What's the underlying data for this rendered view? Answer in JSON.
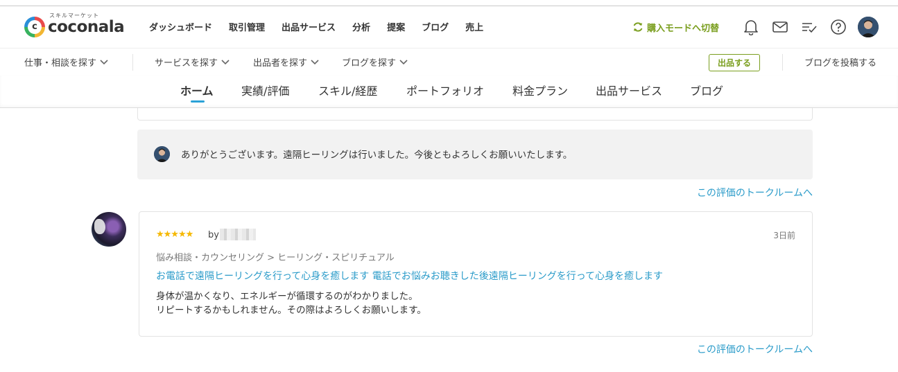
{
  "header": {
    "logo_sub": "スキルマーケット",
    "logo_word": "coconala",
    "nav": [
      "ダッシュボード",
      "取引管理",
      "出品サービス",
      "分析",
      "提案",
      "ブログ",
      "売上"
    ],
    "switch_mode": "購入モードへ切替",
    "icons": [
      "bell-icon",
      "mail-icon",
      "todo-list-icon",
      "help-icon"
    ]
  },
  "subnav": {
    "find_work": "仕事・相談を探す",
    "find_service": "サービスを探す",
    "find_seller": "出品者を探す",
    "find_blog": "ブログを探す",
    "sell_button": "出品する",
    "post_blog": "ブログを投稿する"
  },
  "tabs": [
    "ホーム",
    "実績/評価",
    "スキル/経歴",
    "ポートフォリオ",
    "料金プラン",
    "出品サービス",
    "ブログ"
  ],
  "reply": {
    "text": "ありがとうございます。遠隔ヒーリングは行いました。今後ともよろしくお願いいたします。"
  },
  "talk_room_link": "この評価のトークルームへ",
  "review": {
    "stars": "★★★★★",
    "by": "by",
    "date": "3日前",
    "category": "悩み相談・カウンセリング > ヒーリング・スピリチュアル",
    "service_title": "お電話で遠隔ヒーリングを行って心身を癒します 電話でお悩みお聴きした後遠隔ヒーリングを行って心身を癒します",
    "body_line1": "身体が温かくなり、エネルギーが循環するのがわかりました。",
    "body_line2": "リピートするかもしれません。その際はよろしくお願いします。"
  },
  "colors": {
    "accent_green": "#7a9e1e",
    "link_blue": "#2a9bc9",
    "tab_underline": "#2aa1d7",
    "star": "#f5b800"
  }
}
